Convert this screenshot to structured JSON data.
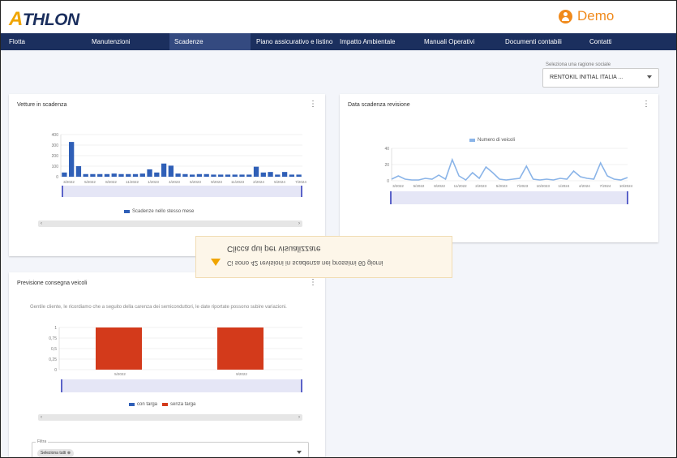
{
  "header": {
    "logo": "ATHLON",
    "user": "Demo"
  },
  "nav": [
    "Flotta",
    "Manutenzioni",
    "Scadenze",
    "Piano assicurativo e listino",
    "Impatto Ambientale",
    "Manuali Operativi",
    "Documenti contabili",
    "Contatti"
  ],
  "company_select": {
    "label": "Seleziona una ragione sociale",
    "value": "RENTOKIL INITIAL ITALIA ..."
  },
  "cards": {
    "scadenza": {
      "title": "Vetture in scadenza",
      "legend": "Scadenze nello stesso mese"
    },
    "revisione": {
      "title": "Data scadenza revisione",
      "legend": "Numero di veicoli"
    },
    "consegna": {
      "title": "Previsione consegna veicoli",
      "note": "Gentile cliente, le ricordiamo che a seguito della carenza dei semiconduttori, le date riportate possono subire variazioni.",
      "legend_a": "con targa",
      "legend_b": "senza targa",
      "filter_label": "Filtra",
      "filter_chip": "Seleziona tutti"
    }
  },
  "toast": {
    "title": "Clicca qui per visualizzare",
    "message": "Ci sono 42 revisioni in scadenza nei prossimi 60 giorni"
  },
  "chart_data": [
    {
      "type": "bar",
      "title": "Vetture in scadenza",
      "ylim": [
        0,
        400
      ],
      "yticks": [
        "400",
        "300",
        "200",
        "100",
        "0"
      ],
      "x_tick_labels": [
        "3/2022",
        "5/2022",
        "8/2022",
        "11/2022",
        "1/2023",
        "4/2023",
        "6/2023",
        "9/2023",
        "11/2023",
        "2/2024",
        "5/2024",
        "7/2024"
      ],
      "series": [
        {
          "name": "Scadenze nello stesso mese",
          "color": "#2f5fb7",
          "values": [
            40,
            330,
            100,
            25,
            25,
            25,
            25,
            30,
            25,
            25,
            25,
            30,
            70,
            40,
            125,
            105,
            30,
            25,
            20,
            25,
            25,
            20,
            20,
            20,
            20,
            20,
            20,
            95,
            40,
            45,
            20,
            45,
            20,
            20
          ]
        }
      ]
    },
    {
      "type": "line",
      "title": "Data scadenza revisione",
      "ylim": [
        0,
        40
      ],
      "yticks": [
        "40",
        "20",
        "0"
      ],
      "x_tick_labels": [
        "3/2022",
        "5/2022",
        "8/2022",
        "11/2022",
        "2/2023",
        "5/2023",
        "7/2023",
        "10/2023",
        "1/2024",
        "4/2024",
        "7/2024",
        "10/2024"
      ],
      "series": [
        {
          "name": "Numero di veicoli",
          "color": "#8ab4e8",
          "values": [
            2,
            6,
            2,
            1,
            1,
            3,
            2,
            7,
            2,
            26,
            6,
            1,
            10,
            3,
            17,
            10,
            2,
            1,
            2,
            3,
            18,
            2,
            1,
            2,
            1,
            3,
            2,
            12,
            5,
            3,
            2,
            22,
            6,
            2,
            1,
            4
          ]
        }
      ]
    },
    {
      "type": "bar",
      "title": "Previsione consegna veicoli",
      "ylim": [
        0,
        1
      ],
      "yticks": [
        "1",
        "0,75",
        "0,5",
        "0,25",
        "0"
      ],
      "categories": [
        "5/2022",
        "9/2022"
      ],
      "series": [
        {
          "name": "con targa",
          "color": "#2f5fb7",
          "values": [
            0,
            0
          ]
        },
        {
          "name": "senza targa",
          "color": "#d33a1b",
          "values": [
            1,
            1
          ]
        }
      ]
    }
  ]
}
